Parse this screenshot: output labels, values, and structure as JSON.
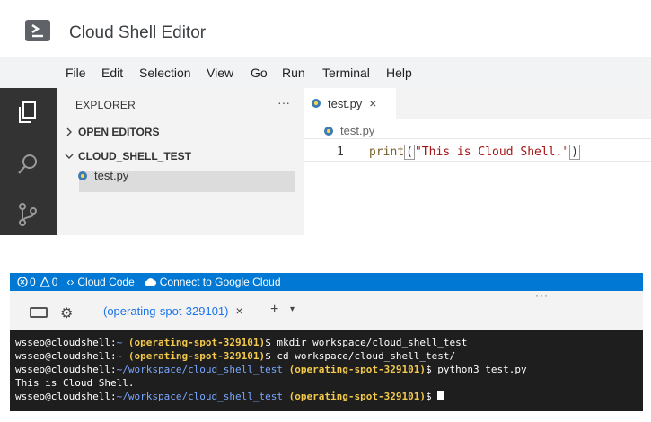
{
  "app": {
    "title": "Cloud Shell Editor"
  },
  "menu": [
    "File",
    "Edit",
    "Selection",
    "View",
    "Go",
    "Run",
    "Terminal",
    "Help"
  ],
  "explorer": {
    "header": "EXPLORER",
    "more": "···",
    "open_editors": "OPEN EDITORS",
    "folder": "CLOUD_SHELL_TEST",
    "file": "test.py"
  },
  "editor": {
    "tab_label": "test.py",
    "tab_close": "×",
    "breadcrumb": "test.py",
    "line_number": "1",
    "code": {
      "fn": "print",
      "open": "(",
      "str": "\"This is Cloud Shell.\"",
      "close": ")"
    }
  },
  "statusbar": {
    "errors": "0",
    "warnings": "0",
    "cloud_code": "Cloud Code",
    "connect": "Connect to Google Cloud"
  },
  "panel": {
    "drag": "···",
    "tab_label": "(operating-spot-329101)",
    "tab_close": "×",
    "add": "+",
    "dropdown": "▾"
  },
  "terminal": {
    "lines": [
      {
        "prompt": "wsseo@cloudshell:",
        "path": "~",
        "proj": " (operating-spot-329101)",
        "cmd": "$ mkdir workspace/cloud_shell_test"
      },
      {
        "prompt": "wsseo@cloudshell:",
        "path": "~",
        "proj": " (operating-spot-329101)",
        "cmd": "$ cd workspace/cloud_shell_test/"
      },
      {
        "prompt": "wsseo@cloudshell:",
        "path": "~/workspace/cloud_shell_test",
        "proj": " (operating-spot-329101)",
        "cmd": "$ python3 test.py"
      },
      {
        "output": "This is Cloud Shell."
      },
      {
        "prompt": "wsseo@cloudshell:",
        "path": "~/workspace/cloud_shell_test",
        "proj": " (operating-spot-329101)",
        "cmd": "$ "
      }
    ]
  },
  "colors": {
    "statusbar": "#0078d4",
    "terminal_bg": "#1e1e1e",
    "activitybar": "#333333",
    "accent": "#1a73e8"
  }
}
